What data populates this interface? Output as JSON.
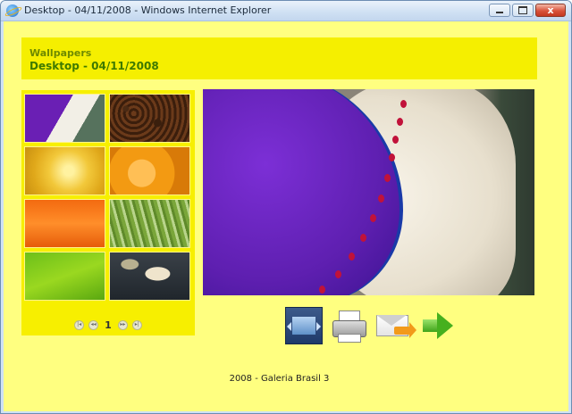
{
  "window": {
    "title": "Desktop - 04/11/2008 - Windows Internet Explorer",
    "buttons": {
      "minimize": "minimize",
      "maximize": "maximize",
      "close": "x"
    }
  },
  "header": {
    "breadcrumb": "Wallpapers",
    "title": "Desktop - 04/11/2008"
  },
  "gallery": {
    "thumbnails": [
      "photo-1",
      "photo-2",
      "photo-3",
      "photo-4",
      "photo-5",
      "photo-6",
      "photo-7",
      "photo-8"
    ],
    "pager": {
      "first": "|◂",
      "prev": "◂◂",
      "current": "1",
      "next": "▸▸",
      "last": "▸|"
    }
  },
  "actions": [
    "fullscreen-icon",
    "printer-icon",
    "email-icon",
    "next-arrow-icon"
  ],
  "footer": {
    "text": "2008 - Galeria Brasil 3"
  },
  "colors": {
    "page_background": "#ffff80",
    "header_background": "#f5ef00",
    "breadcrumb_text": "#6e8a00",
    "title_text": "#3e7a00"
  }
}
